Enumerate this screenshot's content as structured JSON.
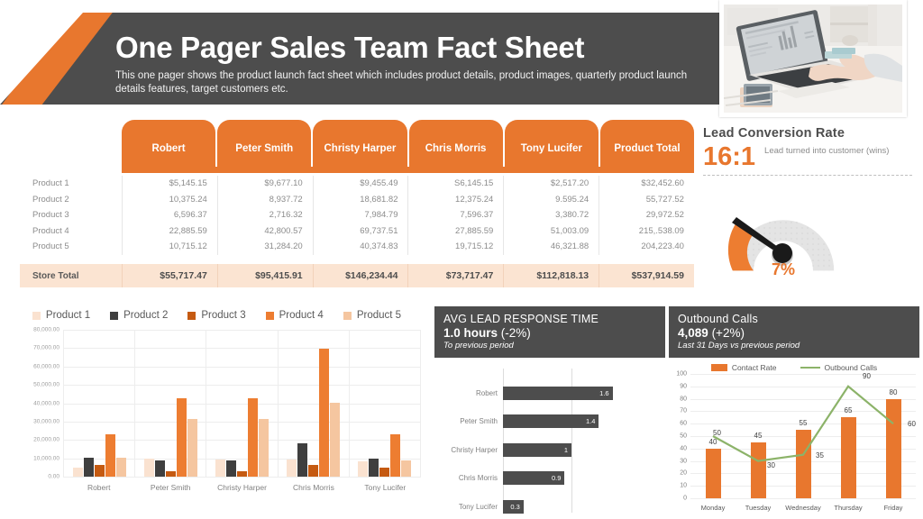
{
  "header": {
    "title": "One Pager Sales Team Fact Sheet",
    "subtitle": "This one pager shows the product launch fact sheet which includes product details, product images, quarterly product launch details features, target customers etc.",
    "photo_alt": "laptop-typing-photo"
  },
  "colors": {
    "orange": "#e8772e",
    "dark": "#4d4d4d",
    "total_row": "#fbe4d2",
    "p1": "#fae2d0",
    "p2": "#3f3f3f",
    "p3": "#c55a11",
    "p4": "#ed7d31",
    "p5": "#f5c6a0",
    "line_green": "#8cb369"
  },
  "table": {
    "row_header": "",
    "columns": [
      "Robert",
      "Peter Smith",
      "Christy Harper",
      "Chris Morris",
      "Tony Lucifer",
      "Product\nTotal"
    ],
    "column_labels": [
      "Robert",
      "Peter Smith",
      "Christy  Harper",
      "Chris Morris",
      "Tony Lucifer",
      "Product Total"
    ],
    "rows": [
      {
        "label": "Product 1",
        "values": [
          "$5,145.15",
          "$9,677.10",
          "$9,455.49",
          "S6,145.15",
          "$2,517.20",
          "$32,452.60"
        ]
      },
      {
        "label": "Product 2",
        "values": [
          "10,375.24",
          "8,937.72",
          "18,681.82",
          "12,375.24",
          "9.595.24",
          "55,727.52"
        ]
      },
      {
        "label": "Product 3",
        "values": [
          "6,596.37",
          "2,716.32",
          "7,984.79",
          "7,596.37",
          "3,380.72",
          "29,972.52"
        ]
      },
      {
        "label": "Product 4",
        "values": [
          "22,885.59",
          "42,800.57",
          "69,737.51",
          "27,885.59",
          "51,003.09",
          "215,.538.09"
        ]
      },
      {
        "label": "Product 5",
        "values": [
          "10,715.12",
          "31,284.20",
          "40,374.83",
          "19,715.12",
          "46,321.88",
          "204,223.40"
        ]
      }
    ],
    "total": {
      "label": "Store Total",
      "values": [
        "$55,717.47",
        "$95,415.91",
        "$146,234.44",
        "$73,717.47",
        "$112,818.13",
        "$537,914.59"
      ]
    }
  },
  "lead_conversion": {
    "title": "Lead Conversion  Rate",
    "ratio": "16:1",
    "description": "Lead turned into customer (wins)",
    "gauge_value_label": "7%",
    "gauge_percent": 7
  },
  "avg_lead_response": {
    "kicker": "AVG LEAD RESPONSE TIME",
    "metric": "1.0 hours",
    "delta": "(-2%)",
    "sub": "To previous period"
  },
  "outbound_calls": {
    "kicker": "Outbound Calls",
    "metric": "4,089",
    "delta": "(+2%)",
    "sub": "Last 31 Days vs previous period"
  },
  "chart_data": [
    {
      "type": "bar",
      "name": "product-sales-by-rep",
      "title": "",
      "xlabel": "",
      "ylabel": "",
      "categories": [
        "Robert",
        "Peter Smith",
        "Christy Harper",
        "Chris Morris",
        "Tony Lucifer"
      ],
      "ylim": [
        0,
        80000
      ],
      "ytick_labels": [
        "0.00",
        "10,000.00",
        "20,000.00",
        "30,000.00",
        "40,000.00",
        "50,000.00",
        "60,000.00",
        "70,000.00",
        "80,000.00"
      ],
      "yticks": [
        0,
        10000,
        20000,
        30000,
        40000,
        50000,
        60000,
        70000,
        80000
      ],
      "grid": true,
      "legend": [
        "Product 1",
        "Product 2",
        "Product 3",
        "Product 4",
        "Product 5"
      ],
      "legend_position": "top",
      "series": [
        {
          "name": "Product 1",
          "color": "#fae2d0",
          "values": [
            5145.15,
            9677.1,
            9455.49,
            9145.15,
            8517.2
          ]
        },
        {
          "name": "Product 2",
          "color": "#3f3f3f",
          "values": [
            10375.24,
            8937.72,
            8681.82,
            18375.24,
            9595.24
          ]
        },
        {
          "name": "Product 3",
          "color": "#c55a11",
          "values": [
            6596.37,
            2716.32,
            2984.79,
            6596.37,
            4880.72
          ]
        },
        {
          "name": "Product 4",
          "color": "#ed7d31",
          "values": [
            22885.59,
            42800.57,
            42737.51,
            69737.51,
            22885.59
          ]
        },
        {
          "name": "Product 5",
          "color": "#f5c6a0",
          "values": [
            10375.12,
            31284.2,
            31374.83,
            40374.83,
            8715.12
          ]
        }
      ]
    },
    {
      "type": "bar",
      "name": "avg-lead-response-time",
      "orientation": "horizontal",
      "title": "AVG LEAD RESPONSE TIME",
      "xlabel": "",
      "ylabel": "",
      "categories": [
        "Robert",
        "Peter Smith",
        "Christy Harper",
        "Chris Morris",
        "Tony Lucifer"
      ],
      "values": [
        1.6,
        1.4,
        1,
        0.9,
        0.3
      ],
      "value_labels": [
        "1.6",
        "1.4",
        "1",
        "0.9",
        "0.3"
      ],
      "xlim": [
        0,
        2
      ],
      "grid": true,
      "gridlines_at": [
        0,
        1
      ],
      "color": "#4d4d4d"
    },
    {
      "type": "line",
      "name": "outbound-calls-weekly",
      "title": "Outbound Calls",
      "xlabel": "",
      "ylabel": "",
      "categories": [
        "Monday",
        "Tuesday",
        "Wednesday",
        "Thursday",
        "Friday"
      ],
      "ylim": [
        0,
        100
      ],
      "yticks": [
        0,
        10,
        20,
        30,
        40,
        50,
        60,
        70,
        80,
        90,
        100
      ],
      "grid": true,
      "legend": [
        "Contact Rate",
        "Outbound Calls"
      ],
      "legend_position": "top",
      "series": [
        {
          "name": "Contact Rate",
          "type": "bar",
          "color": "#e8772e",
          "values": [
            40,
            45,
            55,
            65,
            80
          ],
          "labels": [
            "40",
            "45",
            "55",
            "65",
            "80"
          ]
        },
        {
          "name": "Outbound Calls",
          "type": "line",
          "color": "#8cb369",
          "values": [
            50,
            30,
            35,
            90,
            60
          ],
          "labels": [
            "50",
            "30",
            "35",
            "90",
            "60"
          ]
        }
      ]
    }
  ]
}
